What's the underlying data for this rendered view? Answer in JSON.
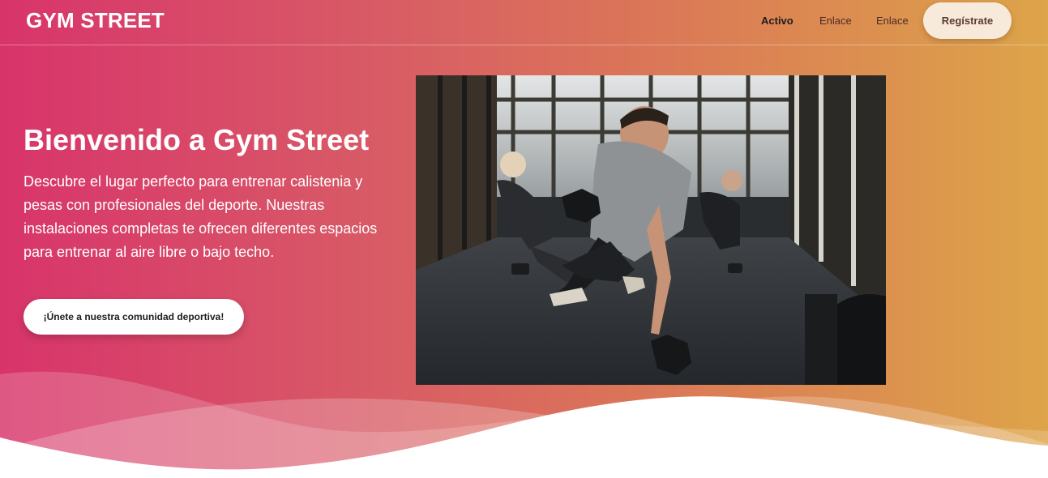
{
  "navbar": {
    "brand": "GYM STREET",
    "links": [
      {
        "label": "Activo",
        "active": true
      },
      {
        "label": "Enlace",
        "active": false
      },
      {
        "label": "Enlace",
        "active": false
      }
    ],
    "register_label": "Regístrate"
  },
  "hero": {
    "title": "Bienvenido a Gym Street",
    "description": "Descubre el lugar perfecto para entrenar calistenia y pesas con profesionales del deporte. Nuestras instalaciones completas te ofrecen diferentes espacios para entrenar al aire libre o bajo techo.",
    "cta_label": "¡Únete a nuestra comunidad deportiva!",
    "image_icon": "gym-training-photo"
  },
  "colors": {
    "gradient_start": "#d8346b",
    "gradient_end": "#dda449",
    "register_bg": "#f8eadb",
    "cta_bg": "#ffffff"
  }
}
